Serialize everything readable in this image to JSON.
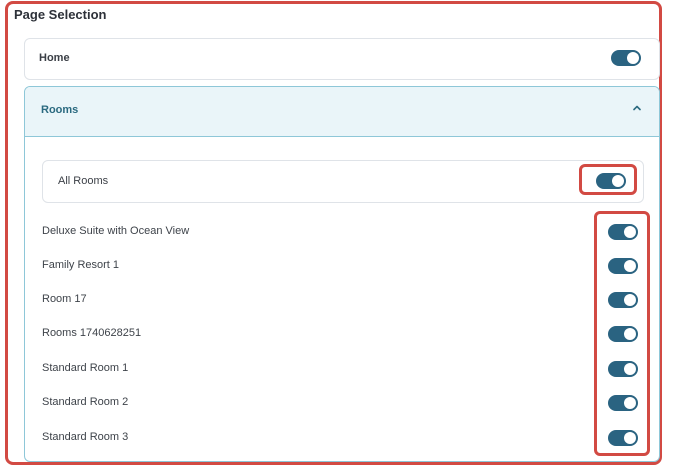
{
  "section": {
    "title": "Page Selection"
  },
  "home": {
    "label": "Home",
    "enabled": true
  },
  "rooms": {
    "label": "Rooms",
    "expanded": true,
    "all_rooms": {
      "label": "All Rooms",
      "enabled": true
    },
    "items": [
      {
        "label": "Deluxe Suite with Ocean View",
        "enabled": true
      },
      {
        "label": "Family Resort 1",
        "enabled": true
      },
      {
        "label": "Room 17",
        "enabled": true
      },
      {
        "label": "Rooms 1740628251",
        "enabled": true
      },
      {
        "label": "Standard Room 1",
        "enabled": true
      },
      {
        "label": "Standard Room 2",
        "enabled": true
      },
      {
        "label": "Standard Room 3",
        "enabled": true
      }
    ]
  },
  "colors": {
    "accent": "#2a6381",
    "highlight": "#d24a43",
    "rooms_header_bg": "#eaf5f9",
    "rooms_border": "#8ec7d8"
  }
}
